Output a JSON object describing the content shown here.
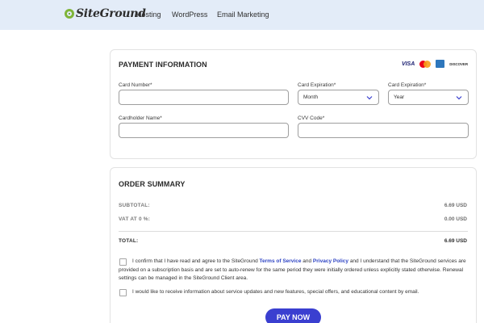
{
  "header": {
    "brand": "SiteGround",
    "nav": [
      "Hosting",
      "WordPress",
      "Email Marketing"
    ]
  },
  "payment": {
    "title": "PAYMENT INFORMATION",
    "card_icons": [
      "visa-icon",
      "mastercard-icon",
      "amex-icon",
      "discover-icon"
    ],
    "visa_text": "VISA",
    "discover_text": "DISCOVER",
    "card_number": {
      "label": "Card Number*",
      "value": ""
    },
    "exp_month": {
      "label": "Card Expiration*",
      "value": "Month"
    },
    "exp_year": {
      "label": "Card Expiration*",
      "value": "Year"
    },
    "holder": {
      "label": "Cardholder Name*",
      "value": ""
    },
    "cvv": {
      "label": "CVV Code*",
      "value": ""
    }
  },
  "order": {
    "title": "ORDER SUMMARY",
    "subtotal_label": "SUBTOTAL:",
    "subtotal_value": "6.69 USD",
    "vat_label": "VAT AT 0 %:",
    "vat_value": "0.00 USD",
    "total_label": "TOTAL:",
    "total_value": "6.69 USD",
    "terms_pre": "I confirm that I have read and agree to the SiteGround ",
    "terms_link": "Terms of Service",
    "terms_mid": " and ",
    "privacy_link": "Privacy Policy",
    "terms_post": " and I understand that the SiteGround services are provided on a subscription basis and are set to auto-renew for the same period they were initially ordered unless explicitly stated otherwise. Renewal settings can be managed in the SiteGround Client area.",
    "marketing": "I would like to receive information about service updates and new features, special offers, and educational content by email.",
    "pay_label": "PAY NOW"
  },
  "colors": {
    "header_bg": "#e3ecf8",
    "brand_green": "#7fb539",
    "link_blue": "#2f45c4",
    "button_blue": "#3a3fd0"
  }
}
